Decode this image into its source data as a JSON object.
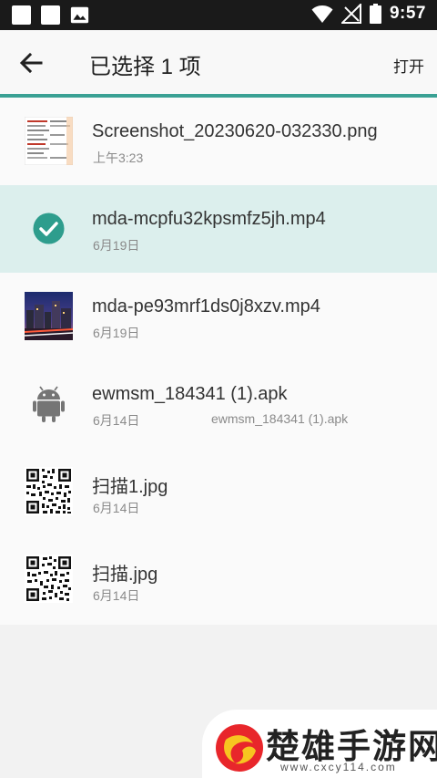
{
  "status_bar": {
    "time": "9:57",
    "icons": [
      "notification-square-icon",
      "notification-square-icon",
      "image-notification-icon",
      "wifi-icon",
      "signal-no-sim-icon",
      "battery-icon"
    ]
  },
  "toolbar": {
    "back_icon": "arrow-back-icon",
    "title": "已选择 1 项",
    "action_label": "打开",
    "accent_color": "#3aa194"
  },
  "files": [
    {
      "name": "Screenshot_20230620-032330.png",
      "date": "上午3:23",
      "summary": "",
      "thumb": "screenshot-thumbnail",
      "selected": false
    },
    {
      "name": "mda-mcpfu32kpsmfz5jh.mp4",
      "date": "6月19日",
      "summary": "",
      "thumb": "check-circle-icon",
      "selected": true
    },
    {
      "name": "mda-pe93mrf1ds0j8xzv.mp4",
      "date": "6月19日",
      "summary": "",
      "thumb": "video-thumbnail",
      "selected": false
    },
    {
      "name": "ewmsm_184341 (1).apk",
      "date": "6月14日",
      "summary": "ewmsm_184341 (1).apk",
      "thumb": "android-icon",
      "selected": false
    },
    {
      "name": "扫描1.jpg",
      "date": "6月14日",
      "summary": "",
      "thumb": "qr-code-thumbnail",
      "selected": false
    },
    {
      "name": "扫描.jpg",
      "date": "6月14日",
      "summary": "",
      "thumb": "qr-code-thumbnail",
      "selected": false
    }
  ],
  "watermark": {
    "title": "楚雄手游网",
    "url": "www.cxcy114.com"
  }
}
